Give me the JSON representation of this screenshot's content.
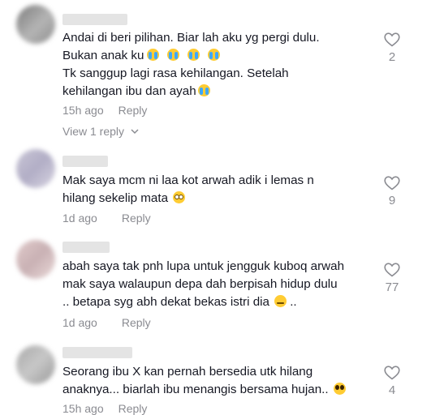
{
  "comments": [
    {
      "lines": [
        {
          "text": "Andai di beri pilihan. Biar lah aku yg pergi dulu.",
          "emojis": []
        },
        {
          "text": "Bukan anak ku",
          "emojis": [
            "cry",
            "cry",
            "cry",
            "cry"
          ]
        },
        {
          "text": "Tk sanggup lagi rasa kehilangan. Setelah",
          "emojis": []
        },
        {
          "text": "kehilangan ibu dan ayah",
          "emojis": [
            "cry"
          ]
        }
      ],
      "time": "15h ago",
      "reply_label": "Reply",
      "view_replies": "View 1 reply",
      "likes": "2"
    },
    {
      "lines": [
        {
          "text": "Mak saya mcm ni laa kot arwah adik i lemas n",
          "emojis": []
        },
        {
          "text": "hilang sekelip mata",
          "emojis": [
            "flushed"
          ]
        }
      ],
      "time": "1d ago",
      "reply_label": "Reply",
      "likes": "9"
    },
    {
      "lines": [
        {
          "text": "abah saya tak pnh lupa untuk jengguk kuboq arwah",
          "emojis": []
        },
        {
          "text": "mak saya walaupun depa dah berpisah hidup dulu",
          "emojis": []
        },
        {
          "text": ".. betapa syg abh dekat bekas istri dia",
          "emojis": [
            "pensive"
          ],
          "suffix": " .."
        }
      ],
      "time": "1d ago",
      "reply_label": "Reply",
      "likes": "77"
    },
    {
      "lines": [
        {
          "text": "Seorang ibu X kan pernah bersedia utk hilang",
          "emojis": []
        },
        {
          "text": "anaknya... biarlah ibu menangis bersama hujan..",
          "emojis": [
            "pleading"
          ]
        }
      ],
      "time": "15h ago",
      "reply_label": "Reply",
      "likes": "4"
    }
  ],
  "colors": {
    "text": "#161823",
    "muted": "#8a8b91",
    "heart_outline": "#8a8b91"
  },
  "icons": {
    "like": "heart-outline-icon",
    "expand": "chevron-down-icon"
  }
}
